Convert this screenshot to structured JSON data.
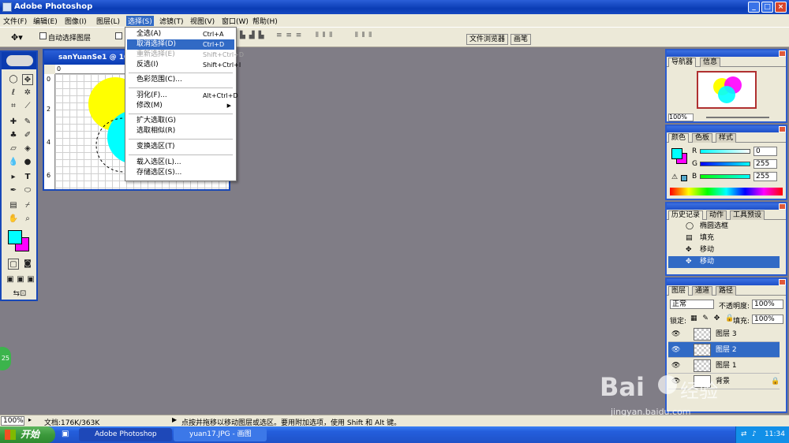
{
  "app": {
    "title": "Adobe Photoshop"
  },
  "menubar": [
    {
      "label": "文件(F)"
    },
    {
      "label": "编辑(E)"
    },
    {
      "label": "图像(I)"
    },
    {
      "label": "图层(L)"
    },
    {
      "label": "选择(S)"
    },
    {
      "label": "滤镜(T)"
    },
    {
      "label": "视图(V)"
    },
    {
      "label": "窗口(W)"
    },
    {
      "label": "帮助(H)"
    }
  ],
  "optionsbar": {
    "auto_select_label": "自动选择图层",
    "file_browser_tab": "文件浏览器",
    "brushes_tab": "画笔"
  },
  "select_menu": {
    "items": [
      {
        "label": "全选(A)",
        "shortcut": "Ctrl+A"
      },
      {
        "label": "取消选择(D)",
        "shortcut": "Ctrl+D"
      },
      {
        "label": "重新选择(E)",
        "shortcut": "Shift+Ctrl+D"
      },
      {
        "label": "反选(I)",
        "shortcut": "Shift+Ctrl+I"
      },
      {
        "label": "色彩范围(C)..."
      },
      {
        "label": "羽化(F)...",
        "shortcut": "Alt+Ctrl+D"
      },
      {
        "label": "修改(M)"
      },
      {
        "label": "扩大选取(G)"
      },
      {
        "label": "选取相似(R)"
      },
      {
        "label": "变换选区(T)"
      },
      {
        "label": "载入选区(L)..."
      },
      {
        "label": "存储选区(S)..."
      }
    ]
  },
  "document": {
    "title": "sanYuanSe1 @ 10",
    "ruler_labels": [
      "0",
      "2",
      "4",
      "6"
    ]
  },
  "navigator": {
    "tabs": [
      "导航器",
      "信息"
    ],
    "zoom": "100%"
  },
  "color": {
    "tabs": [
      "颜色",
      "色板",
      "样式"
    ],
    "channels": [
      {
        "name": "R",
        "value": "0"
      },
      {
        "name": "G",
        "value": "255"
      },
      {
        "name": "B",
        "value": "255"
      }
    ],
    "foreground": "#00ffff",
    "background": "#ff00ff"
  },
  "history": {
    "tabs": [
      "历史记录",
      "动作",
      "工具预设"
    ],
    "items": [
      {
        "label": "椭圆选框"
      },
      {
        "label": "填充"
      },
      {
        "label": "移动"
      },
      {
        "label": "移动"
      }
    ]
  },
  "layers": {
    "tabs": [
      "图层",
      "通道",
      "路径"
    ],
    "blend_mode": "正常",
    "opacity_label": "不透明度:",
    "opacity": "100%",
    "lock_label": "锁定:",
    "fill_label": "填充:",
    "fill": "100%",
    "items": [
      {
        "label": "图层 3"
      },
      {
        "label": "图层 2"
      },
      {
        "label": "图层 1"
      },
      {
        "label": "背景"
      }
    ]
  },
  "statusbar": {
    "zoom": "100%",
    "doc_info": "文档:176K/363K",
    "hint": "点按并拖移以移动图层或选区。要用附加选项，使用 Shift 和 Alt 键。"
  },
  "taskbar": {
    "start_label": "开始",
    "tasks": [
      {
        "label": "Adobe Photoshop"
      },
      {
        "label": "yuan17.JPG - 画图"
      }
    ],
    "clock": "11:34"
  },
  "side_badge": "25",
  "watermark": {
    "brand": "Bai",
    "brand_suffix": "经验",
    "url": "jingyan.baidu.com"
  }
}
